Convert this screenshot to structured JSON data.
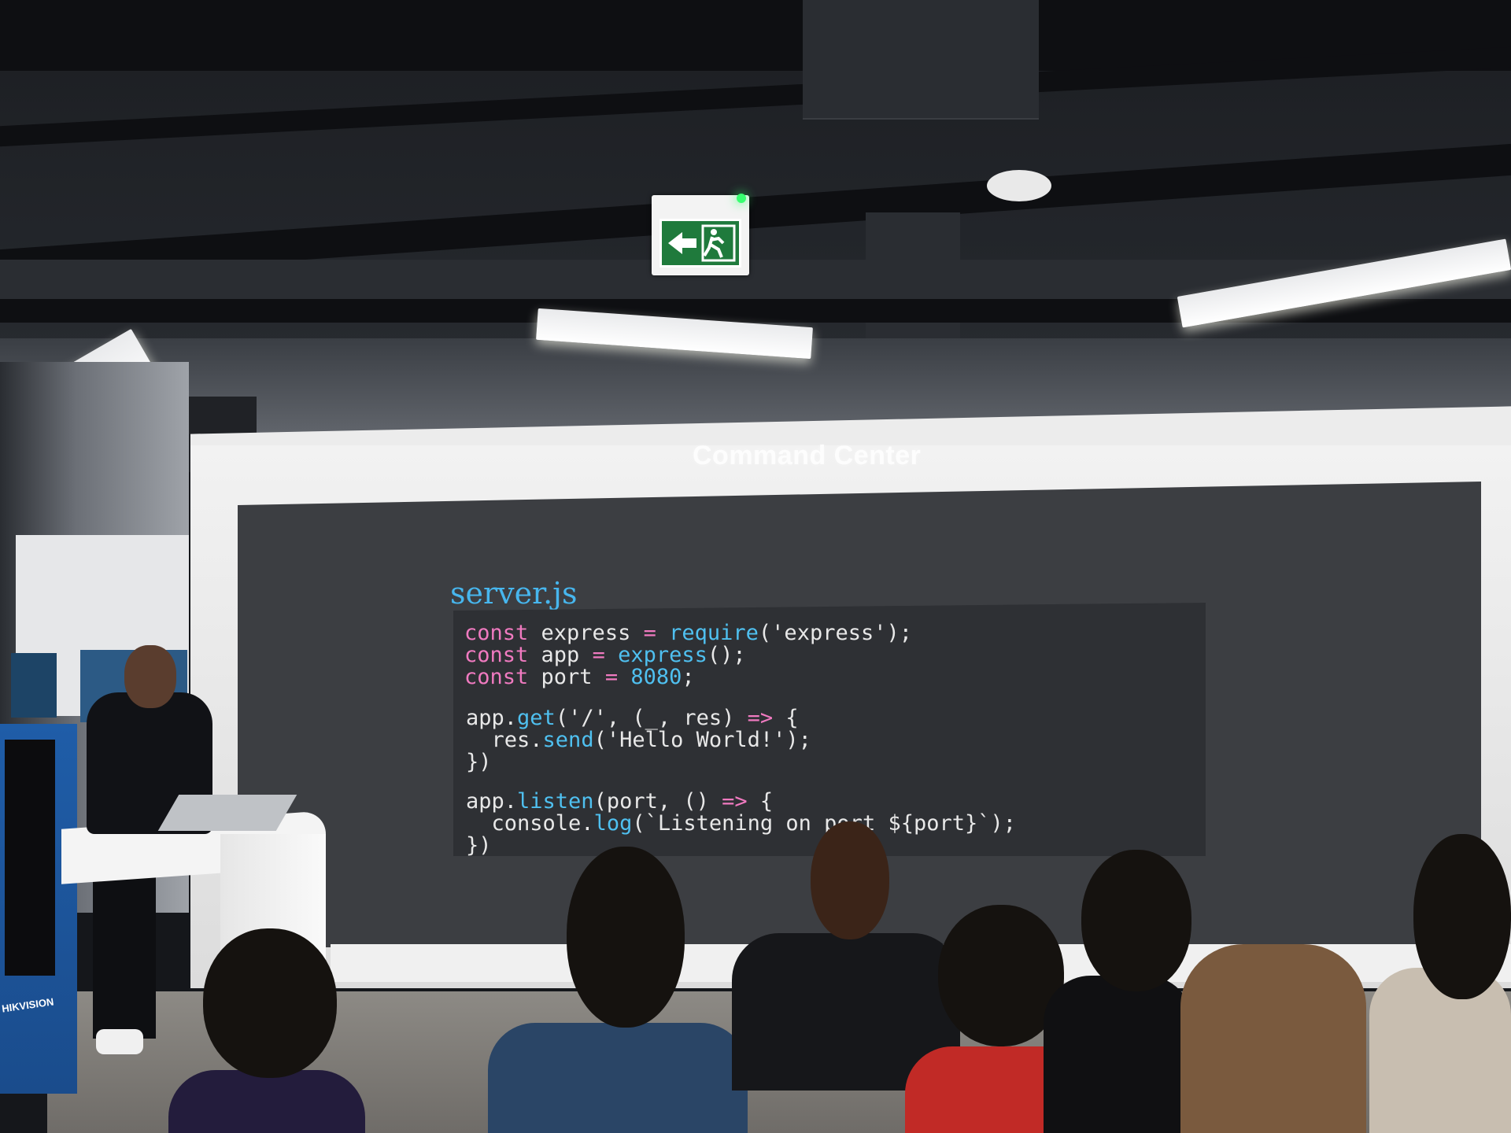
{
  "scene": {
    "brand_label": "Command Center",
    "file_title": "server.js",
    "kiosk_brand": "HIKVISION",
    "code_lines": [
      "const express = require('express');",
      "const app = express();",
      "const port = 8080;",
      "",
      "app.get('/', (_, res) => {",
      "  res.send('Hello World!');",
      "})",
      "",
      "app.listen(port, () => {",
      "  console.log(`Listening on port ${port}`);",
      "})"
    ],
    "colors": {
      "keyword": "#f07ac0",
      "function": "#4fc0f0",
      "exit_sign": "#1f7a3c",
      "kiosk": "#1f5da8"
    },
    "icons": [
      "exit-sign-icon",
      "running-man-icon",
      "arrow-left-icon"
    ]
  }
}
